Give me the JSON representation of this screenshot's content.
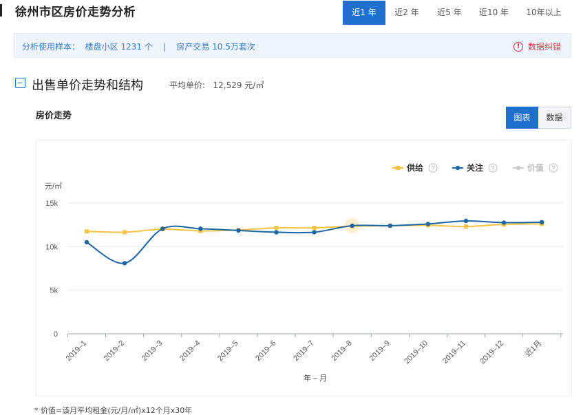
{
  "header": {
    "title": "徐州市区房价走势分析",
    "range_tabs": [
      "近1 年",
      "近2 年",
      "近5 年",
      "近10 年",
      "10年以上"
    ]
  },
  "info_bar": {
    "text": "分析使用样本：  楼盘小区 1231 个    |    房产交易 10.5万套次",
    "correction_label": "数据纠错",
    "correction_icon": "info-circle-icon"
  },
  "section": {
    "title": "出售单价走势和结构",
    "avg_price": "平均单价:   12,529 元/㎡",
    "subtitle": "房价走势",
    "view_buttons": [
      "图表",
      "数据"
    ]
  },
  "footnote": "* 价值=该月平均租金(元/月/㎡)x12个月x30年",
  "colors": {
    "accent": "#1e6fce",
    "supply": "#f5c242",
    "attention": "#1a66a5",
    "value": "#cccccc",
    "alert": "#d9333f"
  },
  "chart_data": {
    "type": "line",
    "ylabel": "元/㎡",
    "xlabel": "年 – 月",
    "y_ticks": [
      "0",
      "5k",
      "10k",
      "15k"
    ],
    "ylim": [
      0,
      15000
    ],
    "categories": [
      "2019–1",
      "2019–2",
      "2019–3",
      "2019–4",
      "2019–5",
      "2019–6",
      "2019–7",
      "2019–8",
      "2019–9",
      "2019–10",
      "2019–11",
      "2019–12",
      "近1月"
    ],
    "series": [
      {
        "name": "供给",
        "color": "#f5c242",
        "marker": "square",
        "values": [
          11750,
          11650,
          12000,
          11800,
          11900,
          12150,
          12150,
          12350,
          12400,
          12450,
          12300,
          12550,
          12600
        ]
      },
      {
        "name": "关注",
        "color": "#1a66a5",
        "marker": "circle",
        "values": [
          10500,
          8100,
          12050,
          12050,
          11850,
          11650,
          11650,
          12400,
          12400,
          12600,
          12950,
          12750,
          12800
        ]
      },
      {
        "name": "价值",
        "color": "#cccccc",
        "marker": "circle",
        "values": []
      }
    ],
    "highlight_index": 7,
    "legend_placement": "top-right",
    "grid": true
  }
}
